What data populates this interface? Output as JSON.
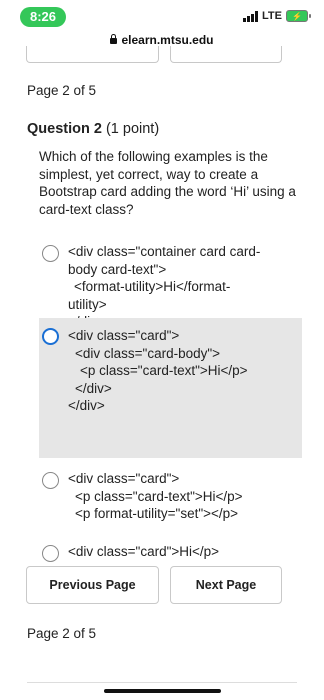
{
  "status_bar": {
    "time": "8:26",
    "network": "LTE"
  },
  "browser": {
    "url": "elearn.mtsu.edu"
  },
  "page_info_top": "Page 2 of 5",
  "page_info_bottom": "Page 2 of 5",
  "question": {
    "label": "Question 2",
    "points": "(1 point)",
    "text": "Which of the following examples is the simplest, yet correct, way to create a Bootstrap card adding the word ‘Hi’ using a card-text class?"
  },
  "options": [
    {
      "selected": false,
      "lines": [
        "<div class=\"container card card-",
        "body card-text\">",
        "<format-utility>Hi</format-",
        "utility>",
        "</div>"
      ]
    },
    {
      "selected": true,
      "lines": [
        "<div class=\"card\">",
        "<div class=\"card-body\">",
        "<p class=\"card-text\">Hi</p>",
        "</div>",
        "</div>"
      ]
    },
    {
      "selected": false,
      "lines": [
        "<div class=\"card\">",
        "<p class=\"card-text\">Hi</p>",
        "<p format-utility=\"set\"></p>"
      ]
    },
    {
      "selected": false,
      "lines": [
        "<div class=\"card\">Hi</p>"
      ]
    }
  ],
  "buttons": {
    "previous": "Previous Page",
    "next": "Next Page"
  }
}
